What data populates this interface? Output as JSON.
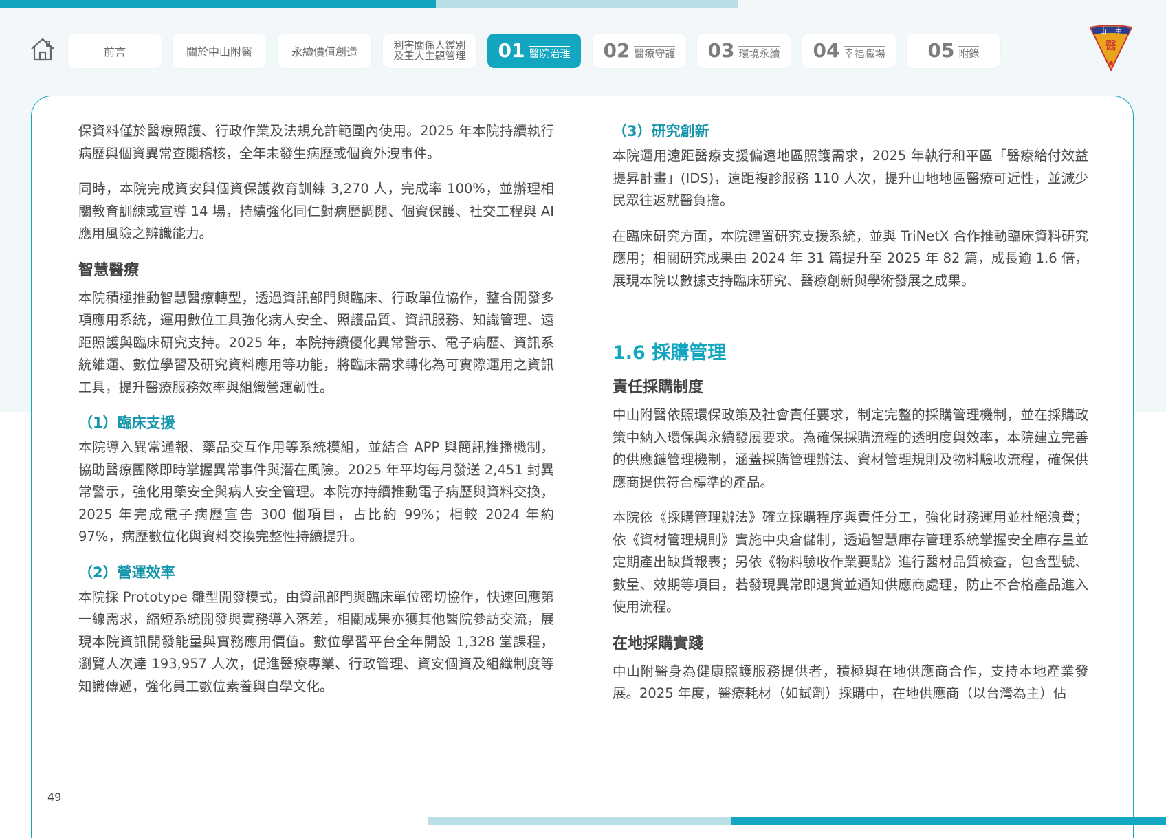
{
  "nav": {
    "home_icon": "home-icon",
    "tabs": [
      {
        "label": "前言"
      },
      {
        "label": "關於中山附醫"
      },
      {
        "label": "永續價值創造"
      },
      {
        "label_line1": "利害關係人鑑別",
        "label_line2": "及重大主題管理"
      },
      {
        "num": "01",
        "label": "醫院治理",
        "active": true
      },
      {
        "num": "02",
        "label": "醫療守護"
      },
      {
        "num": "03",
        "label": "環境永續"
      },
      {
        "num": "04",
        "label": "幸福職場"
      },
      {
        "num": "05",
        "label": "附錄"
      }
    ],
    "logo_text_left": "山",
    "logo_text_right": "中",
    "logo_center": "醫"
  },
  "colors": {
    "accent": "#12a6c0",
    "accent_light": "#b9dfe6",
    "heading_teal": "#1596ab"
  },
  "left": {
    "p1": "保資料僅於醫療照護、行政作業及法規允許範圍內使用。2025 年本院持續執行病歷與個資異常查閱稽核，全年未發生病歷或個資外洩事件。",
    "p2": "同時，本院完成資安與個資保護教育訓練 3,270 人，完成率 100%，並辦理相關教育訓練或宣導 14 場，持續強化同仁對病歷調閱、個資保護、社交工程與 AI 應用風險之辨識能力。",
    "h_smart": "智慧醫療",
    "p3": "本院積極推動智慧醫療轉型，透過資訊部門與臨床、行政單位協作，整合開發多項應用系統，運用數位工具強化病人安全、照護品質、資訊服務、知識管理、遠距照護與臨床研究支持。2025 年，本院持續優化異常警示、電子病歷、資訊系統維運、數位學習及研究資料應用等功能，將臨床需求轉化為可實際運用之資訊工具，提升醫療服務效率與組織營運韌性。",
    "h1": "（1）臨床支援",
    "p4": "本院導入異常通報、藥品交互作用等系統模組，並結合 APP 與簡訊推播機制，協助醫療團隊即時掌握異常事件與潛在風險。2025 年平均每月發送 2,451 封異常警示，強化用藥安全與病人安全管理。本院亦持續推動電子病歷與資料交換，2025 年完成電子病歷宣告 300 個項目，占比約 99%；相較 2024 年約 97%，病歷數位化與資料交換完整性持續提升。",
    "h2": "（2）營運效率",
    "p5": "本院採 Prototype 雛型開發模式，由資訊部門與臨床單位密切協作，快速回應第一線需求，縮短系統開發與實務導入落差，相關成果亦獲其他醫院參訪交流，展現本院資訊開發能量與實務應用價值。數位學習平台全年開設 1,328 堂課程，瀏覽人次達 193,957 人次，促進醫療專業、行政管理、資安個資及組織制度等知識傳遞，強化員工數位素養與自學文化。"
  },
  "right": {
    "h3": "（3）研究創新",
    "p1": "本院運用遠距醫療支援偏遠地區照護需求，2025 年執行和平區「醫療給付效益提昇計畫」(IDS)，遠距複診服務 110 人次，提升山地地區醫療可近性，並減少民眾往返就醫負擔。",
    "p2": "在臨床研究方面，本院建置研究支援系統，並與 TriNetX 合作推動臨床資料研究應用；相關研究成果由 2024 年 31 篇提升至 2025 年 82 篇，成長逾 1.6 倍，展現本院以數據支持臨床研究、醫療創新與學術發展之成果。",
    "section": "1.6 採購管理",
    "h_resp": "責任採購制度",
    "p3": "中山附醫依照環保政策及社會責任要求，制定完整的採購管理機制，並在採購政策中納入環保與永續發展要求。為確保採購流程的透明度與效率，本院建立完善的供應鏈管理機制，涵蓋採購管理辦法、資材管理規則及物料驗收流程，確保供應商提供符合標準的產品。",
    "p4": "本院依《採購管理辦法》確立採購程序與責任分工，強化財務運用並杜絕浪費；依《資材管理規則》實施中央倉儲制，透過智慧庫存管理系統掌握安全庫存量並定期產出缺貨報表；另依《物料驗收作業要點》進行醫材品質檢查，包含型號、數量、效期等項目，若發現異常即退貨並通知供應商處理，防止不合格產品進入使用流程。",
    "h_local": "在地採購實踐",
    "p5": "中山附醫身為健康照護服務提供者，積極與在地供應商合作，支持本地產業發展。2025 年度，醫療耗材（如試劑）採購中，在地供應商（以台灣為主）佔"
  },
  "page_number": "49"
}
